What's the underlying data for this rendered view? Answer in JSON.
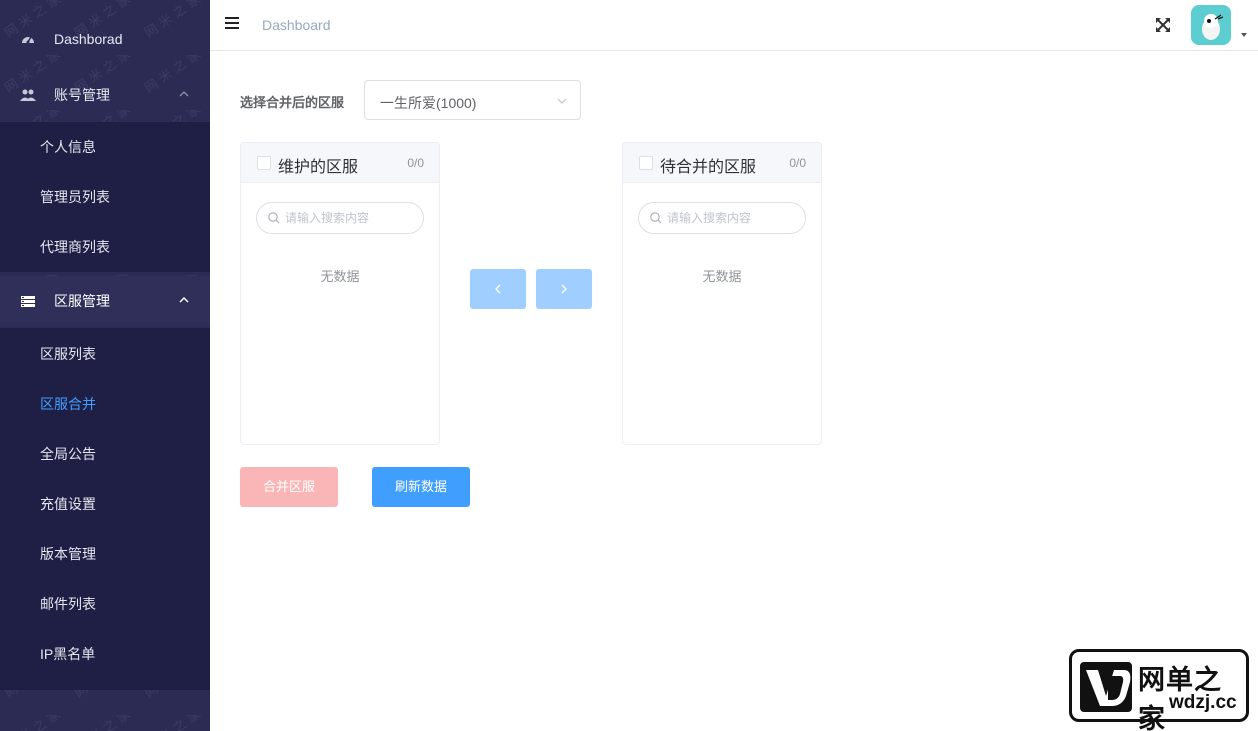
{
  "sidebar": {
    "items": [
      {
        "label": "Dashborad",
        "icon": "dashboard-icon"
      },
      {
        "label": "账号管理",
        "icon": "users-icon"
      },
      {
        "label": "区服管理",
        "icon": "server-icon"
      }
    ],
    "account_sub": [
      "个人信息",
      "管理员列表",
      "代理商列表"
    ],
    "server_sub": [
      "区服列表",
      "区服合并",
      "全局公告",
      "充值设置",
      "版本管理",
      "邮件列表",
      "IP黑名单"
    ],
    "active_item": "区服合并",
    "active_color": "#409eff",
    "bg_color": "#2b2b53"
  },
  "header": {
    "breadcrumb": "Dashboard"
  },
  "main": {
    "select_label": "选择合并后的区服",
    "select_value": "一生所爱(1000)",
    "left_panel": {
      "title": "维护的区服",
      "count": "0/0",
      "placeholder": "请输入搜索内容",
      "empty": "无数据"
    },
    "right_panel": {
      "title": "待合并的区服",
      "count": "0/0",
      "placeholder": "请输入搜索内容",
      "empty": "无数据"
    },
    "merge_button": "合并区服",
    "refresh_button": "刷新数据"
  },
  "logo": {
    "cn": "网单之家",
    "en": "wdzj.cc"
  }
}
